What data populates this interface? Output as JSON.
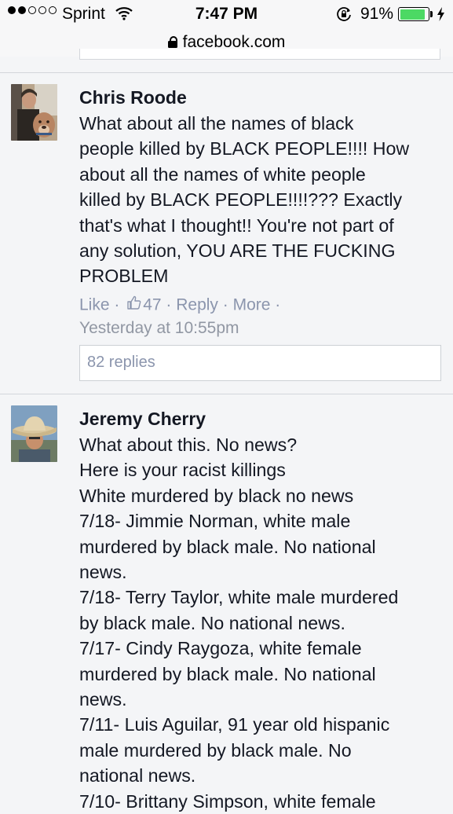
{
  "status_bar": {
    "carrier": "Sprint",
    "time": "7:47 PM",
    "battery_percent": "91%",
    "battery_level": 0.91,
    "signal_bars": 2,
    "signal_bars_total": 5
  },
  "browser": {
    "url": "facebook.com"
  },
  "comments": [
    {
      "author": "Chris Roode",
      "lines": [
        "What about all the names of black",
        "people killed by BLACK PEOPLE!!!! How",
        "about all the names of white people",
        "killed by BLACK PEOPLE!!!!??? Exactly",
        "that's what I thought!! You're not part of",
        "any solution, YOU ARE THE FUCKING",
        "PROBLEM"
      ],
      "actions": {
        "like": "Like",
        "sep": " · ",
        "like_count": "47",
        "reply": "Reply",
        "more": "More"
      },
      "timestamp": "Yesterday at 10:55pm",
      "replies_label": "82 replies"
    },
    {
      "author": "Jeremy Cherry",
      "lines": [
        "What about this. No news?",
        "Here is your racist killings",
        "White murdered by black no news",
        "7/18- Jimmie Norman, white male",
        "murdered by black male. No national",
        "news.",
        "7/18- Terry Taylor, white male murdered",
        "by black male. No national news.",
        "7/17- Cindy Raygoza, white female",
        "murdered by black male. No national",
        "news.",
        "7/11- Luis Aguilar, 91 year old hispanic",
        "male murdered by black male. No",
        "national news.",
        "7/10- Brittany Simpson, white female"
      ]
    }
  ],
  "colors": {
    "background": "#f4f5f7",
    "link_gray_blue": "#8b95ad",
    "timestamp_gray": "#9197a3",
    "battery_green": "#4cd964",
    "text": "#141823"
  }
}
